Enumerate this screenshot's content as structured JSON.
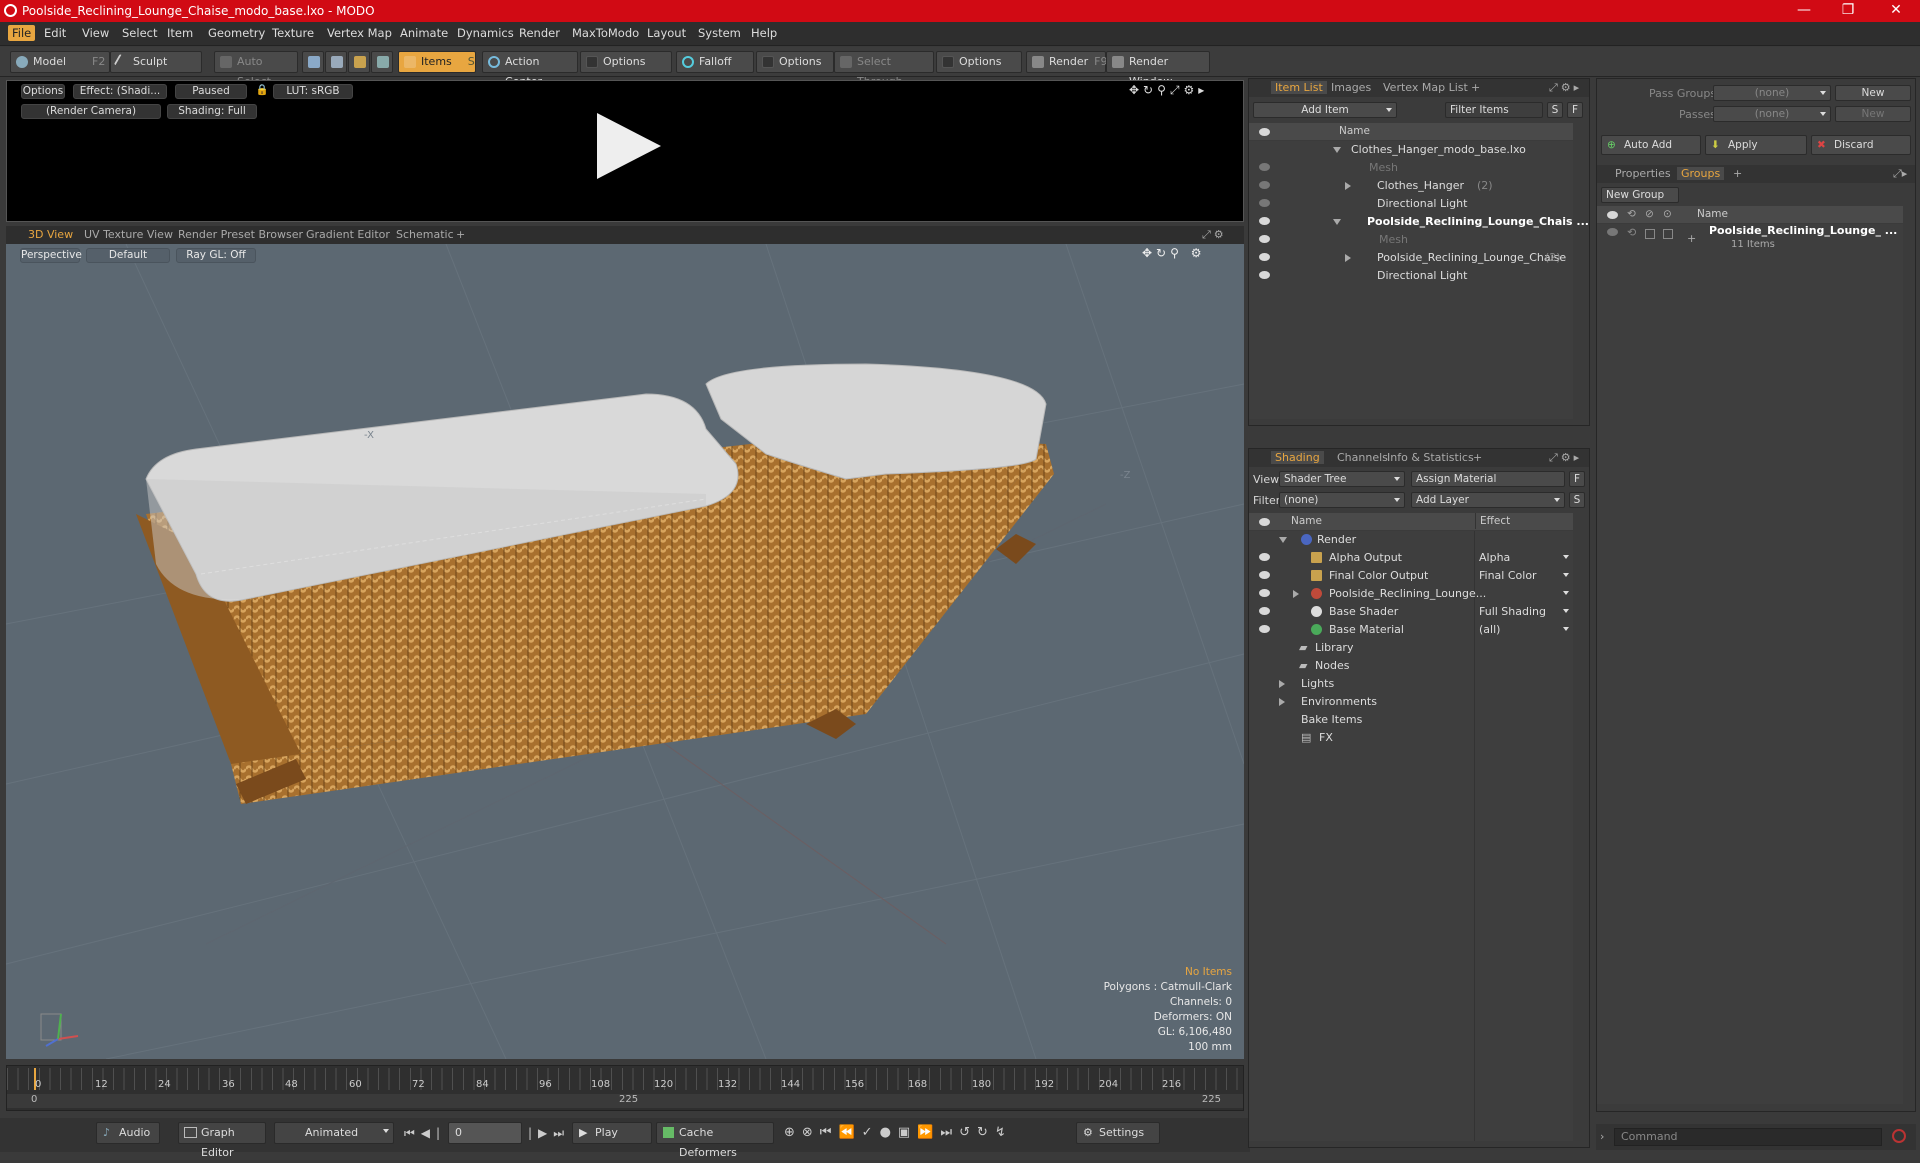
{
  "window": {
    "title": "Poolside_Reclining_Lounge_Chaise_modo_base.lxo - MODO"
  },
  "menu": [
    "File",
    "Edit",
    "View",
    "Select",
    "Item",
    "Geometry",
    "Texture",
    "Vertex Map",
    "Animate",
    "Dynamics",
    "Render",
    "MaxToModo",
    "Layout",
    "System",
    "Help"
  ],
  "toolbar": {
    "model": "Model",
    "model_key": "F2",
    "sculpt": "Sculpt",
    "auto_select": "Auto Select",
    "items": "Items",
    "items_key": "S",
    "action_center": "Action Center",
    "options": "Options",
    "falloff": "Falloff",
    "select_through": "Select Through",
    "render": "Render",
    "render_key": "F9",
    "render_window": "Render Window"
  },
  "render_preview": {
    "options": "Options",
    "effect": "Effect: (Shadi...",
    "paused": "Paused",
    "lut": "LUT: sRGB",
    "camera": "(Render Camera)",
    "shading": "Shading: Full"
  },
  "viewport_tabs": [
    "3D View",
    "UV Texture View",
    "Render Preset Browser",
    "Gradient Editor",
    "Schematic",
    "+"
  ],
  "viewport": {
    "projection": "Perspective",
    "style": "Default",
    "raygl": "Ray GL: Off",
    "axis_x": "-X",
    "axis_z": "-Z",
    "stats": [
      "No Items",
      "Polygons : Catmull-Clark",
      "Channels: 0",
      "Deformers: ON",
      "GL: 6,106,480",
      "100 mm"
    ]
  },
  "timeline": {
    "ticks": [
      "0",
      "12",
      "24",
      "36",
      "48",
      "60",
      "72",
      "84",
      "96",
      "108",
      "120",
      "132",
      "144",
      "156",
      "168",
      "180",
      "192",
      "204",
      "216"
    ],
    "range_start": "0",
    "range_mid": "225",
    "range_end": "225"
  },
  "bottombar": {
    "audio": "Audio",
    "graph_editor": "Graph Editor",
    "animated": "Animated",
    "frame": "0",
    "play": "Play",
    "cache_deformers": "Cache Deformers",
    "settings": "Settings"
  },
  "item_list": {
    "tabs": [
      "Item List",
      "Images",
      "Vertex Map List",
      "+"
    ],
    "add_item": "Add Item",
    "filter_items": "Filter Items",
    "s": "S",
    "f": "F",
    "col_name": "Name",
    "rows": [
      {
        "label": "Clothes_Hanger_modo_base.lxo",
        "extra": ""
      },
      {
        "label": "Mesh",
        "extra": ""
      },
      {
        "label": "Clothes_Hanger",
        "extra": "(2)"
      },
      {
        "label": "Directional Light",
        "extra": ""
      },
      {
        "label": "Poolside_Reclining_Lounge_Chais ...",
        "extra": ""
      },
      {
        "label": "Mesh",
        "extra": ""
      },
      {
        "label": "Poolside_Reclining_Lounge_Chaise",
        "extra": "(2)"
      },
      {
        "label": "Directional Light",
        "extra": ""
      }
    ]
  },
  "shading": {
    "tabs": [
      "Shading",
      "Channels",
      "Info & Statistics",
      "+"
    ],
    "view_label": "View",
    "view_value": "Shader Tree",
    "assign_material": "Assign Material",
    "filter_label": "Filter",
    "filter_value": "(none)",
    "add_layer": "Add Layer",
    "f": "F",
    "s": "S",
    "col_name": "Name",
    "col_effect": "Effect",
    "rows": [
      {
        "label": "Render",
        "effect": ""
      },
      {
        "label": "Alpha Output",
        "effect": "Alpha"
      },
      {
        "label": "Final Color Output",
        "effect": "Final Color"
      },
      {
        "label": "Poolside_Reclining_Lounge...",
        "effect": ""
      },
      {
        "label": "Base Shader",
        "effect": "Full Shading"
      },
      {
        "label": "Base Material",
        "effect": "(all)"
      },
      {
        "label": "Library",
        "effect": ""
      },
      {
        "label": "Nodes",
        "effect": ""
      },
      {
        "label": "Lights",
        "effect": ""
      },
      {
        "label": "Environments",
        "effect": ""
      },
      {
        "label": "Bake Items",
        "effect": ""
      },
      {
        "label": "FX",
        "effect": ""
      }
    ]
  },
  "groups_panel": {
    "pass_groups_label": "Pass Groups",
    "pass_groups_value": "(none)",
    "new": "New",
    "passes_label": "Passes",
    "passes_value": "(none)",
    "new2": "New",
    "auto_add": "Auto Add",
    "apply": "Apply",
    "discard": "Discard",
    "tabs": [
      "Properties",
      "Groups",
      "+"
    ],
    "new_group": "New Group",
    "col_name": "Name",
    "group_name": "Poolside_Reclining_Lounge_ ...",
    "group_count": "11 Items"
  },
  "command": {
    "placeholder": "Command"
  },
  "colors": {
    "accent": "#e8a640",
    "title_bar": "#d10a14",
    "viewport_bg": "#5c6872",
    "wicker": "#b07a36",
    "cushion": "#d6d6d6"
  }
}
